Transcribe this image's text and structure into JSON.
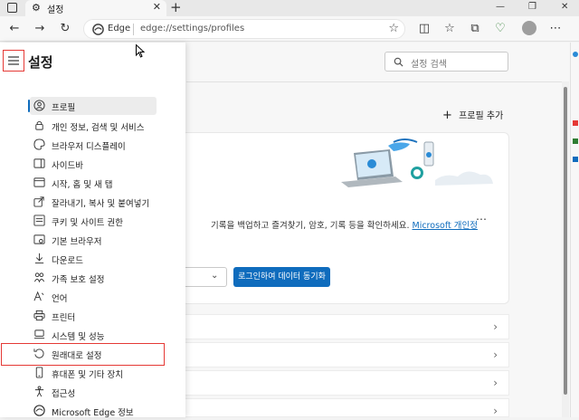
{
  "tab": {
    "title": "설정"
  },
  "address": {
    "brand": "Edge",
    "url": "edge://settings/profiles"
  },
  "sidebar": {
    "title": "설정",
    "items": [
      {
        "label": "프로필",
        "icon": "profile-icon",
        "active": true
      },
      {
        "label": "개인 정보, 검색 및 서비스",
        "icon": "lock-icon"
      },
      {
        "label": "브라우저 디스플레이",
        "icon": "palette-icon"
      },
      {
        "label": "사이드바",
        "icon": "sidebar-icon"
      },
      {
        "label": "시작, 홈 및 새 탭",
        "icon": "home-icon"
      },
      {
        "label": "잘라내기, 복사 및 붙여넣기",
        "icon": "share-icon"
      },
      {
        "label": "쿠키 및 사이트 권한",
        "icon": "cookie-icon"
      },
      {
        "label": "기본 브라우저",
        "icon": "default-browser-icon"
      },
      {
        "label": "다운로드",
        "icon": "download-icon"
      },
      {
        "label": "가족 보호 설정",
        "icon": "family-icon"
      },
      {
        "label": "언어",
        "icon": "language-icon"
      },
      {
        "label": "프린터",
        "icon": "printer-icon"
      },
      {
        "label": "시스템 및 성능",
        "icon": "system-icon"
      },
      {
        "label": "원래대로 설정",
        "icon": "reset-icon"
      },
      {
        "label": "휴대폰 및 기타 장치",
        "icon": "phone-icon"
      },
      {
        "label": "접근성",
        "icon": "accessibility-icon"
      },
      {
        "label": "Microsoft Edge 정보",
        "icon": "edge-icon"
      }
    ]
  },
  "main": {
    "search_placeholder": "설정 검색",
    "add_profile": "프로필 추가",
    "card": {
      "description": "기록을 백업하고 즐겨찾기, 암호, 기록 등을 확인하세요.",
      "link": "Microsoft 개인정",
      "sync_button": "로그인하여 데이터 동기화"
    }
  },
  "colors": {
    "accent": "#0f6cbd",
    "highlight": "#e53935"
  }
}
